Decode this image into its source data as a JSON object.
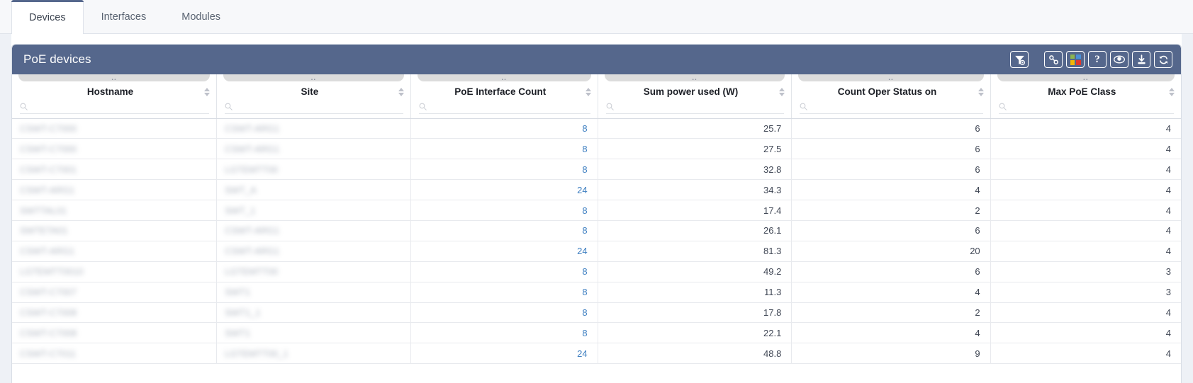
{
  "tabs": [
    {
      "label": "Devices",
      "active": true
    },
    {
      "label": "Interfaces",
      "active": false
    },
    {
      "label": "Modules",
      "active": false
    }
  ],
  "panel": {
    "title": "PoE devices",
    "header_color": "#55678c",
    "tools": [
      {
        "name": "filter-settings-icon",
        "title": "Filter settings"
      },
      {
        "name": "link-icon",
        "title": "Permalink"
      },
      {
        "name": "color-grid-icon",
        "title": "Legend"
      },
      {
        "name": "help-icon",
        "title": "Help",
        "label": "?"
      },
      {
        "name": "eye-icon",
        "title": "Show / hide columns"
      },
      {
        "name": "download-icon",
        "title": "Export"
      },
      {
        "name": "refresh-icon",
        "title": "Refresh"
      }
    ],
    "tool_colors": {
      "green": "#8cb550",
      "blue": "#4a90d9",
      "yellow": "#f2b705",
      "red": "#e0382d"
    }
  },
  "table": {
    "search_placeholder": "",
    "columns": [
      {
        "key": "hostname",
        "label": "Hostname",
        "align": "left",
        "sortable": true,
        "search": true
      },
      {
        "key": "site",
        "label": "Site",
        "align": "left",
        "sortable": true,
        "search": true
      },
      {
        "key": "count",
        "label": "PoE Interface Count",
        "align": "right",
        "sortable": true,
        "search": true
      },
      {
        "key": "power",
        "label": "Sum power used (W)",
        "align": "right",
        "sortable": true,
        "search": true
      },
      {
        "key": "oper",
        "label": "Count Oper Status on",
        "align": "right",
        "sortable": true,
        "search": true
      },
      {
        "key": "class",
        "label": "Max PoE Class",
        "align": "right",
        "sortable": true,
        "search": true
      }
    ],
    "search_values": [
      "",
      "",
      "",
      "",
      "",
      ""
    ],
    "rows": [
      {
        "hostname": "CSWT-C7000",
        "site": "CSWT-ARG1",
        "redacted": true,
        "count": "8",
        "power": "25.7",
        "oper": "6",
        "class": "4"
      },
      {
        "hostname": "CSWT-C7000",
        "site": "CSWT-ARG1",
        "redacted": true,
        "count": "8",
        "power": "27.5",
        "oper": "6",
        "class": "4"
      },
      {
        "hostname": "CSWT-C7001",
        "site": "LGTEMTT00",
        "redacted": true,
        "count": "8",
        "power": "32.8",
        "oper": "6",
        "class": "4"
      },
      {
        "hostname": "CSWT-ARG1",
        "site": "SWT_A",
        "redacted": true,
        "count": "24",
        "power": "34.3",
        "oper": "4",
        "class": "4"
      },
      {
        "hostname": "SWTTAL01",
        "site": "SWT_1",
        "redacted": true,
        "count": "8",
        "power": "17.4",
        "oper": "2",
        "class": "4"
      },
      {
        "hostname": "SWTETA01",
        "site": "CSWT-ARG1",
        "redacted": true,
        "count": "8",
        "power": "26.1",
        "oper": "6",
        "class": "4"
      },
      {
        "hostname": "CSWT-ARG1",
        "site": "CSWT-ARG1",
        "redacted": true,
        "count": "24",
        "power": "81.3",
        "oper": "20",
        "class": "4"
      },
      {
        "hostname": "LGTEMTT0010",
        "site": "LGTEMTT00",
        "redacted": true,
        "count": "8",
        "power": "49.2",
        "oper": "6",
        "class": "3"
      },
      {
        "hostname": "CSWT-C7007",
        "site": "SWT1",
        "redacted": true,
        "count": "8",
        "power": "11.3",
        "oper": "4",
        "class": "3"
      },
      {
        "hostname": "CSWT-C7008",
        "site": "SWT1_1",
        "redacted": true,
        "count": "8",
        "power": "17.8",
        "oper": "2",
        "class": "4"
      },
      {
        "hostname": "CSWT-C7008",
        "site": "SWT1",
        "redacted": true,
        "count": "8",
        "power": "22.1",
        "oper": "4",
        "class": "4"
      },
      {
        "hostname": "CSWT-C7011",
        "site": "LGTEMTT00_1",
        "redacted": true,
        "count": "24",
        "power": "48.8",
        "oper": "9",
        "class": "4"
      }
    ]
  }
}
